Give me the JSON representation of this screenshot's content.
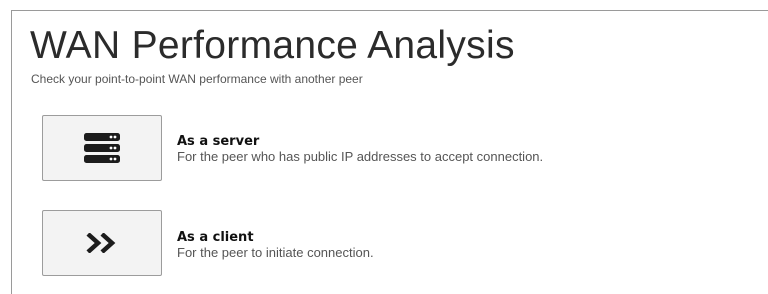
{
  "page": {
    "title": "WAN Performance Analysis",
    "subtitle": "Check your point-to-point WAN performance with another peer"
  },
  "options": [
    {
      "icon": "server-icon",
      "label": "As a server",
      "description": "For the peer who has public IP addresses to accept connection."
    },
    {
      "icon": "double-chevron-right-icon",
      "label": "As a client",
      "description": "For the peer to initiate connection."
    }
  ],
  "colors": {
    "icon": "#1c1c1c",
    "button_bg": "#f3f3f3",
    "button_border": "#9c9c9c",
    "frame_border": "#9a9a9a"
  }
}
